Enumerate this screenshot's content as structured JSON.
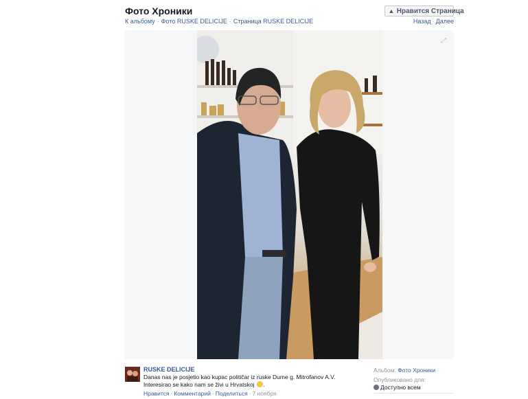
{
  "header": {
    "album_title": "Фото Хроники",
    "like_page_button": "Нравится Страница"
  },
  "breadcrumb": {
    "back_to_album": "К альбому",
    "photos_of_page": "Фото RUSKE DELICIJE",
    "page_link": "Страница RUSKE DELICIJE"
  },
  "pager": {
    "prev": "Назад",
    "next": "Далее"
  },
  "post": {
    "page_name": "RUSKE DELICIJE",
    "caption": "Danas nas je posjetio kao kupac političar iz ruske Dume g. Mitrofanov A.V. Interesirao se kako nam se živi u Hrvatskoj",
    "actions": {
      "like": "Нравится",
      "comment": "Комментарий",
      "share": "Поделиться",
      "date": "7 ноября"
    }
  },
  "sidebar": {
    "album_label": "Альбом:",
    "album_link": "Фото Хроники",
    "published_label": "Опубликовано для:",
    "privacy": "Доступно всем"
  },
  "icons": {
    "like": "thumbs-up-icon",
    "expand": "fullscreen-icon",
    "privacy": "globe-icon"
  },
  "colors": {
    "link": "#3b5998",
    "muted": "#90949c",
    "stage": "#f6f7f9"
  }
}
